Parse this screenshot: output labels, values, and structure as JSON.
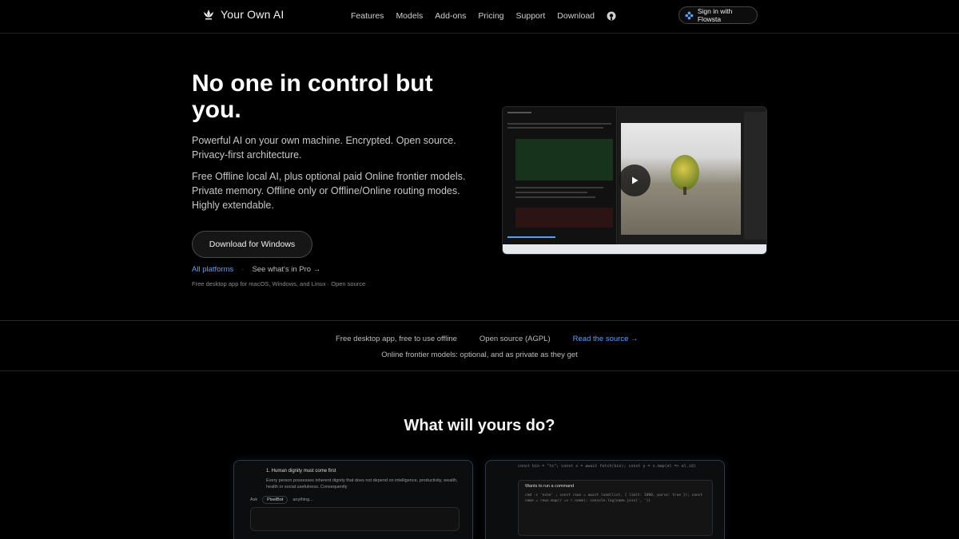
{
  "nav": {
    "brand": "Your Own AI",
    "links": [
      "Features",
      "Models",
      "Add-ons",
      "Pricing",
      "Support",
      "Download"
    ],
    "signin_label": "Sign in with Flowsta"
  },
  "hero": {
    "title": "No one in control but you.",
    "subtitle": "Powerful AI on your own machine. Encrypted. Open source. Privacy-first architecture.",
    "detail": "Free Offline local AI, plus optional paid Online frontier models. Private memory. Offline only or Offline/Online routing modes. Highly extendable.",
    "download_label": "Download for Windows",
    "all_platforms": "All platforms",
    "pro_link": "See what's in Pro →",
    "fine_print": "Free desktop app for macOS, Windows, and Linux · Open source"
  },
  "band": {
    "item1": "Free desktop app, free to use offline",
    "item2": "Open source (AGPL)",
    "source_link": "Read the source →",
    "note": "Online frontier models: optional, and as private as they get"
  },
  "section": {
    "title": "What will yours do?"
  },
  "card1": {
    "heading": "1. Human dignity must come first",
    "body": "Every person possesses inherent dignity that does not depend on intelligence, productivity, wealth, health or social usefulness. Consequently",
    "ask_label": "Ask",
    "chip_label": "PixelBot",
    "ask_suffix": "anything..."
  },
  "card2": {
    "code": "const bin = \"ts\"; const x = await fetch(bin); const y = x.map(el => el.id)",
    "box_title": "Wants to run a command",
    "box_code": "cmd  -c 'echo' ; const rows = await load(list, { limit: 1000, parse: true }); const name = rows.map(r => r.name); console.log(name.join(', '))"
  },
  "colors": {
    "accent_link": "#4da3ff",
    "background": "#000000"
  }
}
